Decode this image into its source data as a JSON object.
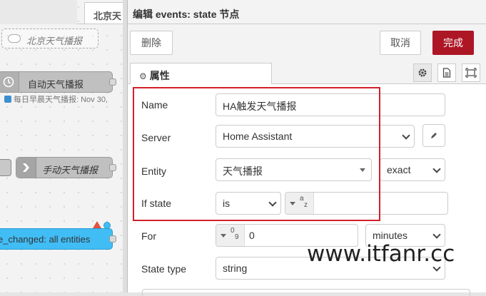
{
  "canvas": {
    "tab_label": "北京天",
    "comment_label": "北京天气播报",
    "auto_node_label": "自动天气播报",
    "auto_node_status": "每日早晨天气播报: Nov 30,",
    "manual_node_label": "手动天气播报",
    "ha_node_label": "e_changed: all entities"
  },
  "tray": {
    "title": "编辑 events: state 节点",
    "delete_label": "删除",
    "cancel_label": "取消",
    "done_label": "完成",
    "tab_properties_label": "属性",
    "accent_color": "#ad1625"
  },
  "form": {
    "name_label": "Name",
    "name_value": "HA触发天气播报",
    "server_label": "Server",
    "server_value": "Home Assistant",
    "entity_label": "Entity",
    "entity_value": "天气播报",
    "entity_match": "exact",
    "if_state_label": "If state",
    "if_state_op": "is",
    "if_state_type_top": "a",
    "if_state_type_bottom": "z",
    "for_label": "For",
    "for_type_top": "0",
    "for_type_bottom": "9",
    "for_value": "0",
    "for_unit": "minutes",
    "state_type_label": "State type",
    "state_type_value": "string"
  },
  "watermark": "www.itfanr.cc",
  "icons": [
    "gear-icon",
    "document-icon",
    "frame-icon",
    "pencil-icon",
    "comment-icon",
    "timer-icon",
    "arrow-icon"
  ]
}
